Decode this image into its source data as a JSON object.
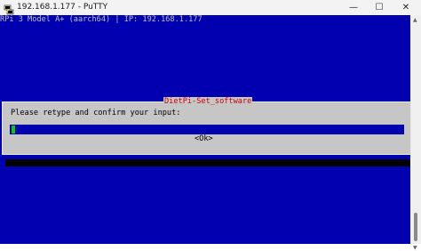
{
  "window": {
    "title": "192.168.1.177 - PuTTY",
    "icon": "putty-icon",
    "controls": {
      "minimize": "—",
      "maximize": "☐",
      "close": "✕"
    }
  },
  "terminal": {
    "header_line": "RPi 3 Model A+ (aarch64) | IP: 192.168.1.177",
    "background_color": "#0000b0",
    "text_color": "#c0c0c0"
  },
  "dialog": {
    "title": "DietPi-Set_software",
    "prompt": "Please retype and confirm your input:",
    "input_value": "",
    "ok_label": "<Ok>",
    "title_color": "#d00000",
    "background_color": "#c6c6c6",
    "cursor_color": "#00d000"
  }
}
